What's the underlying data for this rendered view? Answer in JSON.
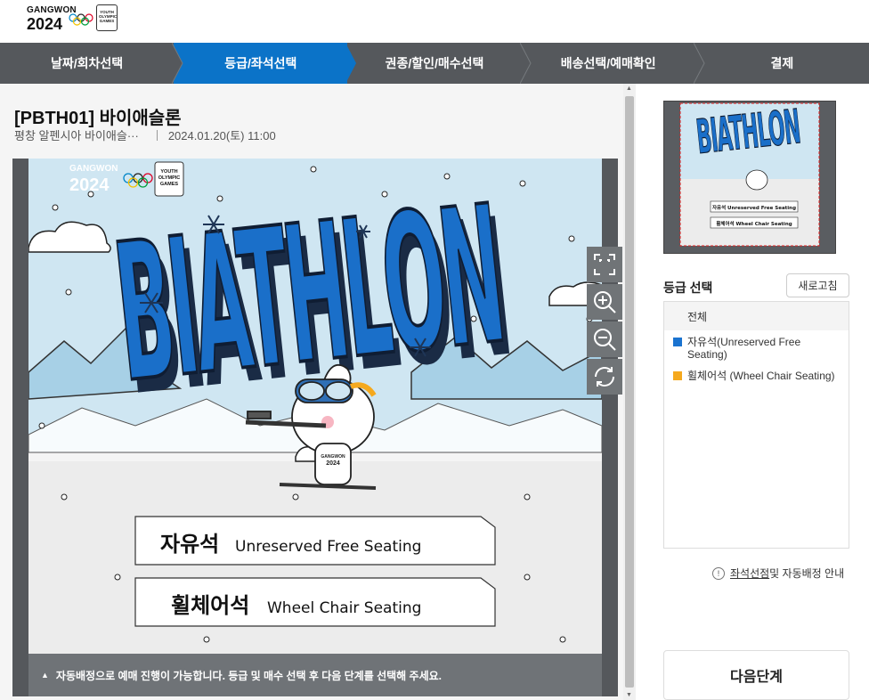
{
  "header": {
    "logo_line1": "GANGWON",
    "logo_line2": "2024",
    "badge_line1": "YOUTH",
    "badge_line2": "OLYMPIC",
    "badge_line3": "GAMES"
  },
  "steps": [
    {
      "label": "날짜/회차선택",
      "active": false
    },
    {
      "label": "등급/좌석선택",
      "active": true
    },
    {
      "label": "권종/할인/매수선택",
      "active": false
    },
    {
      "label": "배송선택/예매확인",
      "active": false
    },
    {
      "label": "결제",
      "active": false
    }
  ],
  "event": {
    "title": "[PBTH01] 바이애슬론",
    "venue": "평창 알펜시아 바이애슬···",
    "datetime": "2024.01.20(토) 11:00"
  },
  "poster": {
    "headline": "BIATHLON",
    "logo_line1": "GANGWON",
    "logo_line2": "2024",
    "badge_line1": "YOUTH",
    "badge_line2": "OLYMPIC",
    "badge_line3": "GAMES",
    "zone1_ko": "자유석",
    "zone1_en": "Unreserved Free Seating",
    "zone2_ko": "휠체어석",
    "zone2_en": "Wheel Chair Seating",
    "mascot_bib_line1": "GANGWON",
    "mascot_bib_line2": "2024"
  },
  "controls": {
    "fit_icon": "fit-screen-icon",
    "zoom_in_icon": "zoom-in-icon",
    "zoom_out_icon": "zoom-out-icon",
    "reset_icon": "rotate-icon"
  },
  "notice": {
    "arrow": "▲",
    "text": "자동배정으로 예매 진행이 가능합니다. 등급 및 매수 선택 후 다음 단계를 선택해 주세요."
  },
  "sidebar": {
    "grade_title": "등급 선택",
    "refresh_label": "새로고침",
    "all_label": "전체",
    "grades": [
      {
        "label": "자유석(Unreserved Free Seating)",
        "color": "#1a73d0"
      },
      {
        "label": "휠체어석 (Wheel Chair Seating)",
        "color": "#f5a91e"
      }
    ],
    "guide_info": "!",
    "guide_underlined": "좌석선점",
    "guide_rest": " 및 자동배정 안내",
    "next_label": "다음단계"
  },
  "colors": {
    "step_bar": "#55585c",
    "step_active": "#0b73c8",
    "headline_blue": "#1a6fc9",
    "sky": "#cfe6f2"
  }
}
